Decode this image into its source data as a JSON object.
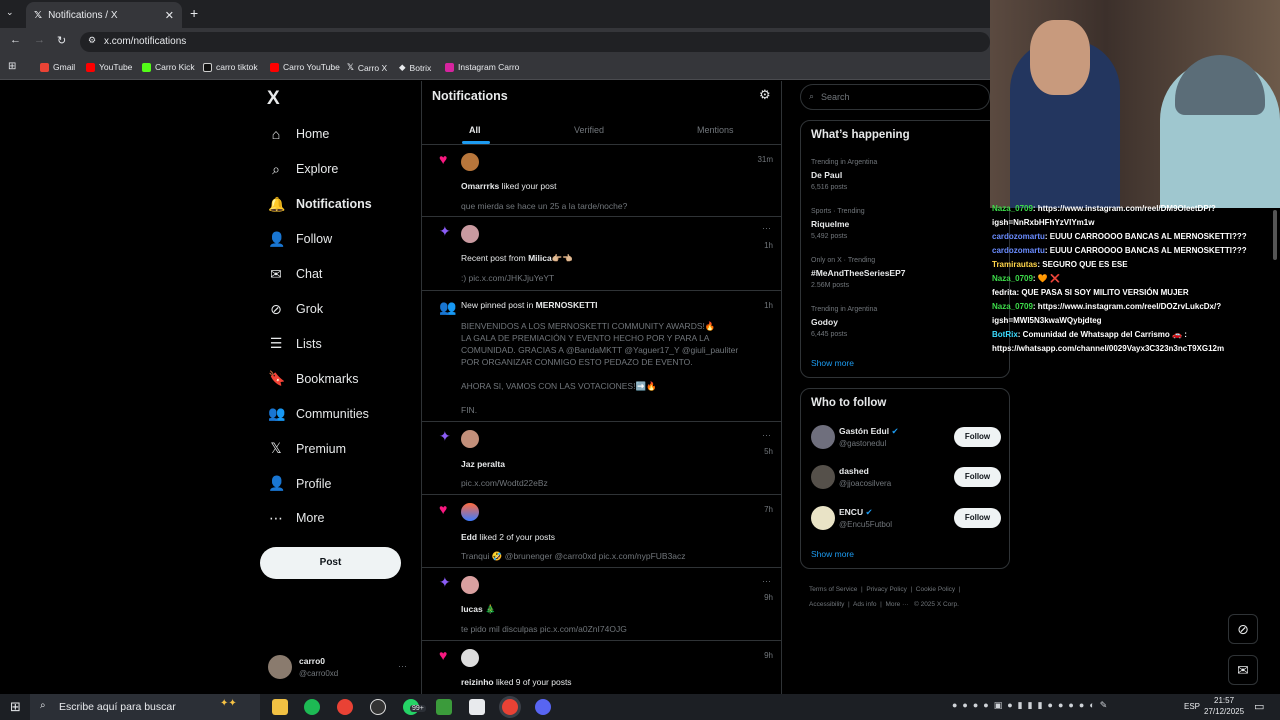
{
  "browser": {
    "tab_title": "Notifications / X",
    "tab_close": "✕",
    "new_tab": "+",
    "url": "x.com/notifications",
    "bookmarks": [
      "Gmail",
      "YouTube",
      "Carro Kick",
      "carro tiktok",
      "Carro YouTube",
      "Carro X",
      "Botrix",
      "Instagram Carro"
    ]
  },
  "sidebar": {
    "logo": "X",
    "items": [
      {
        "label": "Home",
        "icon": "home-icon"
      },
      {
        "label": "Explore",
        "icon": "search-icon"
      },
      {
        "label": "Notifications",
        "icon": "bell-icon"
      },
      {
        "label": "Follow",
        "icon": "person-add-icon"
      },
      {
        "label": "Chat",
        "icon": "mail-icon"
      },
      {
        "label": "Grok",
        "icon": "grok-icon"
      },
      {
        "label": "Lists",
        "icon": "list-icon"
      },
      {
        "label": "Bookmarks",
        "icon": "bookmark-icon"
      },
      {
        "label": "Communities",
        "icon": "communities-icon"
      },
      {
        "label": "Premium",
        "icon": "x-icon"
      },
      {
        "label": "Profile",
        "icon": "person-icon"
      },
      {
        "label": "More",
        "icon": "more-circle-icon"
      }
    ],
    "post_button": "Post",
    "account_name": "carro0",
    "account_handle": "@carro0xd"
  },
  "notifications": {
    "title": "Notifications",
    "tabs": [
      "All",
      "Verified",
      "Mentions"
    ],
    "items": [
      {
        "type": "like",
        "user": "Omarrrks",
        "action": " liked your post",
        "text": "que mierda se hace un 25 a la tarde/noche?",
        "time": "31m"
      },
      {
        "type": "recent",
        "action": "Recent post from ",
        "user": "Milica👉🏼👈🏼",
        "text": ":) pic.x.com/JHKJjuYeYT",
        "time": "1h"
      },
      {
        "type": "pinned",
        "action": "New pinned post in ",
        "user": "MERNOSKETTI",
        "lines": [
          "BIENVENIDOS A LOS MERNOSKETTI COMMUNITY AWARDS!🔥",
          "LA GALA DE PREMIACIÓN Y EVENTO HECHO POR Y PARA LA",
          "COMUNIDAD. GRACIAS A @BandaMKTT @Yaguer17_Y @giuli_pauliter",
          "POR ORGANIZAR CONMIGO ESTO PEDAZO DE EVENTO.",
          "",
          "AHORA SI, VAMOS CON LAS VOTACIONES!➡️🔥",
          "",
          "FIN."
        ],
        "time": "1h"
      },
      {
        "type": "recent",
        "user": "Jaz peralta",
        "text": "pic.x.com/Wodtd22eBz",
        "time": "5h"
      },
      {
        "type": "like",
        "user": "Edd",
        "action": " liked 2 of your posts",
        "text": "Tranqui 🤣 @brunenger @carro0xd pic.x.com/nypFUB3acz",
        "time": "7h"
      },
      {
        "type": "recent",
        "user": "lucas 🎄",
        "text": "te pido mil disculpas pic.x.com/a0ZnI74OJG",
        "time": "9h"
      },
      {
        "type": "like",
        "user": "reizinho",
        "action": " liked 9 of your posts",
        "time": "9h"
      }
    ]
  },
  "right": {
    "search_placeholder": "Search",
    "happening_title": "What’s happening",
    "trends": [
      {
        "meta": "Trending in Argentina",
        "name": "De Paul",
        "posts": "6,516 posts"
      },
      {
        "meta": "Sports · Trending",
        "name": "Riquelme",
        "posts": "5,492 posts"
      },
      {
        "meta": "Only on X · Trending",
        "name": "#MeAndTheeSeriesEP7",
        "posts": "2.56M posts"
      },
      {
        "meta": "Trending in Argentina",
        "name": "Godoy",
        "posts": "6,445 posts"
      }
    ],
    "show_more": "Show more",
    "who_title": "Who to follow",
    "who": [
      {
        "name": "Gastón Edul",
        "handle": "@gastonedul",
        "verified": true
      },
      {
        "name": "dashed",
        "handle": "@jjoacosilvera",
        "verified": false
      },
      {
        "name": "ENCU",
        "handle": "@Encu5Futbol",
        "verified": true
      }
    ],
    "follow_label": "Follow",
    "footer1": [
      "Terms of Service",
      "|",
      "Privacy Policy",
      "|",
      "Cookie Policy",
      "|"
    ],
    "footer2": [
      "Accessibility",
      "|",
      "Ads info",
      "|",
      "More ···",
      "© 2025 X Corp."
    ]
  },
  "chat": [
    {
      "user": "Naza_0709",
      "msg": ": https://www.instagram.com/reel/DM9OleetDP/?",
      "ucolor": "#3ddc4a"
    },
    {
      "user": "",
      "msg": "igsh=NnRxbHFhYzVlYm1w",
      "ucolor": "#ffffff"
    },
    {
      "user": "cardozomartu",
      "msg": ": EUUU CARROOOO BANCAS AL MERNOSKETTI???",
      "ucolor": "#6a8cff"
    },
    {
      "user": "cardozomartu",
      "msg": ": EUUU CARROOOO BANCAS AL MERNOSKETTI???",
      "ucolor": "#6a8cff"
    },
    {
      "user": "Tramirautas",
      "msg": ": SEGURO QUE ES ESE",
      "ucolor": "#ffd54a"
    },
    {
      "user": "Naza_0709",
      "msg": ": 🧡 ❌",
      "ucolor": "#3ddc4a"
    },
    {
      "user": "fedrita",
      "msg": ": QUE PASA SI SOY MILITO VERSIÓN MUJER",
      "ucolor": "#ffffff"
    },
    {
      "user": "Naza_0709",
      "msg": ": https://www.instagram.com/reel/DOZrvLukcDx/?",
      "ucolor": "#3ddc4a"
    },
    {
      "user": "",
      "msg": "igsh=MWI5N3kwaWQybjdteg",
      "ucolor": "#ffffff"
    },
    {
      "user": "BotRix",
      "msg": ": Comunidad de Whatsapp del Carrismo 🚗 :",
      "ucolor": "#3ddcff"
    },
    {
      "user": "",
      "msg": "https://whatsapp.com/channel/0029Vayx3C323n3ncT9XG12m",
      "ucolor": "#ffffff"
    }
  ],
  "taskbar": {
    "search_placeholder": "Escribe aquí para buscar",
    "lang": "ESP",
    "time": "21:57",
    "date": "27/12/2025",
    "badge": "99+"
  },
  "colors": {
    "like": "#f91880",
    "recent": "#8b5cf6",
    "pinned": "#1d9bf0",
    "accent": "#1d9bf0"
  }
}
